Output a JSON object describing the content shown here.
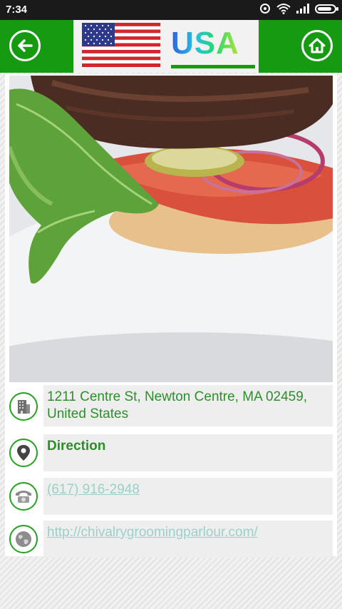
{
  "status_bar": {
    "time": "7:34"
  },
  "header": {
    "brand_text": "USA",
    "back_icon": "back-arrow-icon",
    "home_icon": "home-icon",
    "accent_color": "#159a12"
  },
  "photo": {
    "description_icon": "burger-photo"
  },
  "details": {
    "address": "1211 Centre St, Newton Centre, MA 02459, United States",
    "direction_label": "Direction",
    "phone": "(617) 916-2948",
    "website": "http://chivalrygroomingparlour.com/"
  }
}
